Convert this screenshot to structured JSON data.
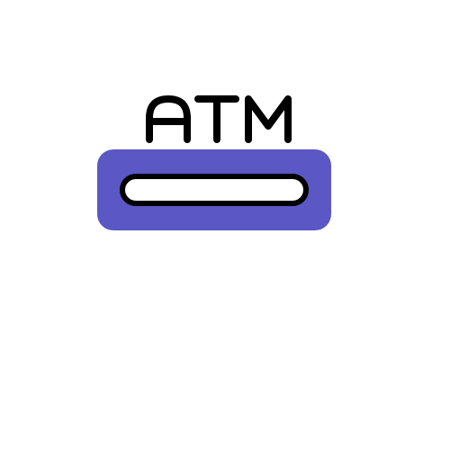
{
  "icon": {
    "name": "atm-card-slot-icon",
    "label": "ATM"
  },
  "colors": {
    "background": "#ffffff",
    "slot_panel": "#5b57c4",
    "slot_fill": "#ffffff",
    "stroke": "#000000"
  }
}
